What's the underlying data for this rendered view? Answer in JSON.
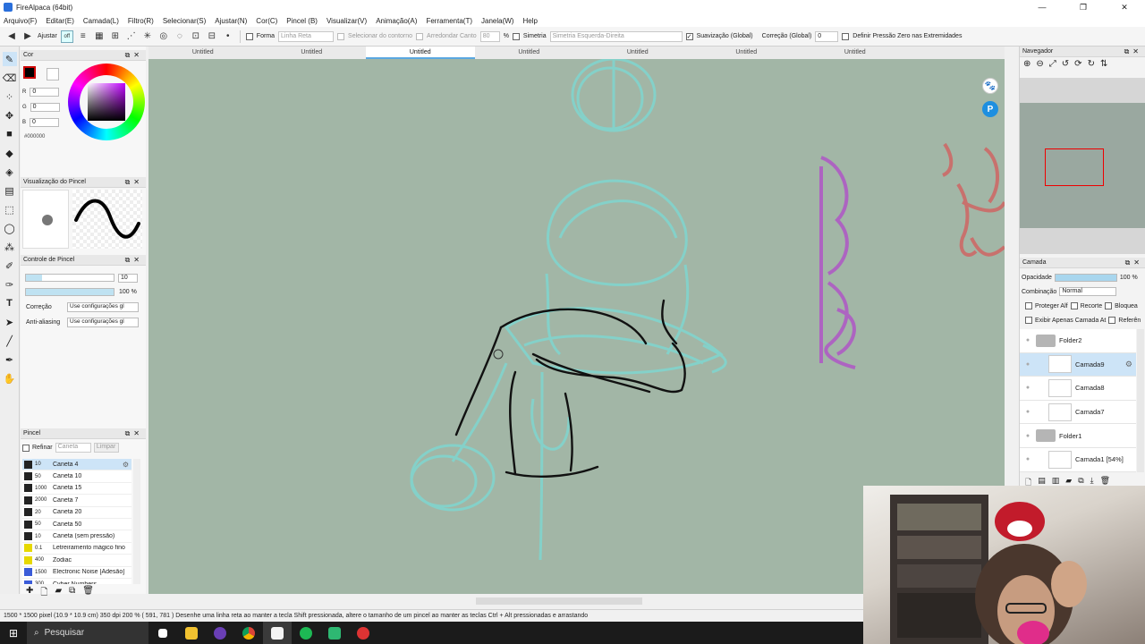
{
  "window": {
    "title": "FireAlpaca (64bit)",
    "minimize": "—",
    "maximize": "❐",
    "close": "✕"
  },
  "menu": [
    "Arquivo(F)",
    "Editar(E)",
    "Camada(L)",
    "Filtro(R)",
    "Selecionar(S)",
    "Ajustar(N)",
    "Cor(C)",
    "Pincel (B)",
    "Visualizar(V)",
    "Animação(A)",
    "Ferramenta(T)",
    "Janela(W)",
    "Help"
  ],
  "toolbar": {
    "ajustar": "Ajustar",
    "off": "off",
    "forma": "Forma",
    "linha_reta": "Linha Reta",
    "selecionar_contorno": "Selecionar do contorno",
    "arredondar": "Arredondar Canto",
    "arredondar_val": "80",
    "pct": "%",
    "simetria": "Simetria",
    "simetria_val": "Simetria Esquerda-Direita",
    "suavizacao": "Suavização (Global)",
    "correcao": "Correção (Global)",
    "correcao_val": "0",
    "pressao": "Definir Pressão Zero nas Extremidades"
  },
  "cor": {
    "title": "Cor",
    "r_label": "R",
    "r": "0",
    "g_label": "G",
    "g": "0",
    "b_label": "B",
    "b": "0",
    "hex": "#000000"
  },
  "visualizacao": {
    "title": "Visualização do Pincel"
  },
  "controle": {
    "title": "Controle de Pincel",
    "size_val": "10",
    "opacity_val": "100 %",
    "opacity": 1.0,
    "correcao_label": "Correção",
    "correcao_val": "Use configurações gl",
    "antialias_label": "Anti-aliasing",
    "antialias_val": "Use configurações gl"
  },
  "pincel": {
    "title": "Pincel",
    "refinar": "Refinar",
    "filter_placeholder": "Caneta",
    "limpar": "Limpar",
    "brushes": [
      {
        "size": "10",
        "name": "Caneta 4",
        "color": "#222222",
        "selected": true
      },
      {
        "size": "50",
        "name": "Caneta 10",
        "color": "#222222"
      },
      {
        "size": "1000",
        "name": "Caneta 15",
        "color": "#222222"
      },
      {
        "size": "2000",
        "name": "Caneta 7",
        "color": "#222222"
      },
      {
        "size": "20",
        "name": "Caneta 20",
        "color": "#222222"
      },
      {
        "size": "50",
        "name": "Caneta 50",
        "color": "#222222"
      },
      {
        "size": "10",
        "name": "Caneta (sem pressão)",
        "color": "#222222"
      },
      {
        "size": "0.1",
        "name": "Letreiramento mágico fino",
        "color": "#e6d800"
      },
      {
        "size": "400",
        "name": "Zodiac",
        "color": "#e6d800"
      },
      {
        "size": "1500",
        "name": "Electronic Noise [Adesão]",
        "color": "#3a5bd8"
      },
      {
        "size": "300",
        "name": "Cyber Numbers",
        "color": "#3a5bd8"
      }
    ]
  },
  "tabs": [
    "Untitled",
    "Untitled",
    "Untitled",
    "Untitled",
    "Untitled",
    "Untitled",
    "Untitled"
  ],
  "active_tab": 2,
  "navegador": {
    "title": "Navegador"
  },
  "camada": {
    "title": "Camada",
    "opacidade_label": "Opacidade",
    "opacidade_val": "100 %",
    "combinacao_label": "Combinação",
    "combinacao_val": "Normal",
    "proteger": "Proteger Alf",
    "recorte": "Recorte",
    "bloquear": "Bloquea",
    "exibir": "Exibir Apenas Camada At",
    "referencia": "Referên",
    "layers": [
      {
        "name": "Folder2",
        "type": "folder"
      },
      {
        "name": "Camada9",
        "type": "layer",
        "selected": true
      },
      {
        "name": "Camada8",
        "type": "layer"
      },
      {
        "name": "Camada7",
        "type": "layer"
      },
      {
        "name": "Folder1",
        "type": "folder"
      },
      {
        "name": "Camada1 [54%]",
        "type": "layer"
      }
    ]
  },
  "status": "1500 * 1500 pixel  (10.9 * 10.9 cm)  350 dpi  200 %  ( 591, 781 )  Desenhe uma linha reta ao manter a tecla Shift pressionada, altere o tamanho de um pincel ao manter as teclas Ctrl + Alt pressionadas e arrastando",
  "taskbar": {
    "search": "Pesquisar"
  },
  "colors": {
    "canvas_bg": "#a2b6a6",
    "sketch_cyan": "#7fd6d0",
    "ink": "#111111",
    "accent": "#5aa7e0"
  }
}
